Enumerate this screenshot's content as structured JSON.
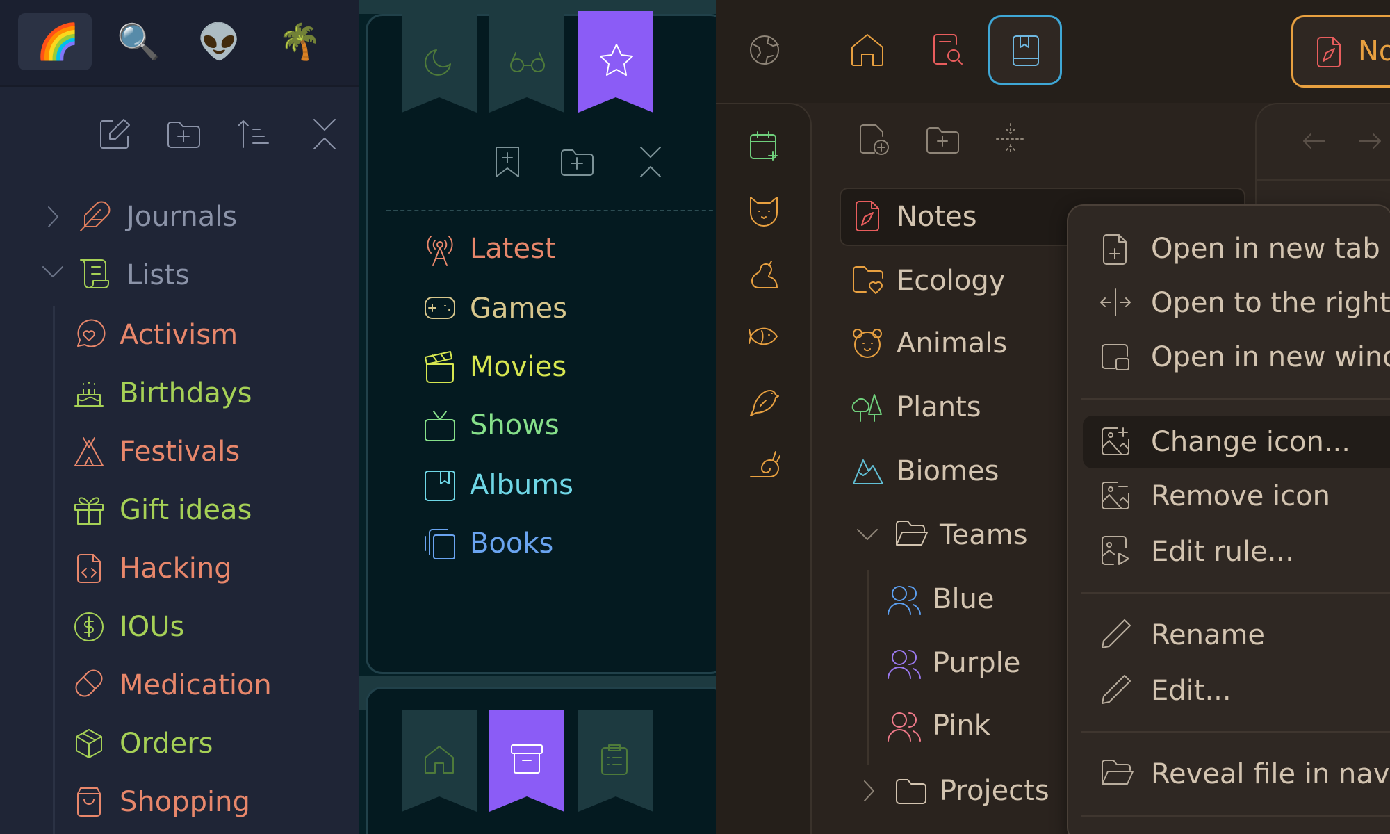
{
  "pane1": {
    "tabs": [
      "🌈",
      "🔍",
      "👽",
      "🌴"
    ],
    "folders": [
      {
        "label": "Journals",
        "color": "#e07e5c",
        "icon": "feather-icon"
      },
      {
        "label": "Lists",
        "color": "#a6d156",
        "icon": "scroll-icon"
      }
    ],
    "items": [
      {
        "label": "Activism",
        "color": "#e8876b",
        "icon": "heart-message-icon"
      },
      {
        "label": "Birthdays",
        "color": "#a6d156",
        "icon": "cake-icon"
      },
      {
        "label": "Festivals",
        "color": "#e8876b",
        "icon": "tent-icon"
      },
      {
        "label": "Gift ideas",
        "color": "#a6d156",
        "icon": "gift-icon"
      },
      {
        "label": "Hacking",
        "color": "#e8876b",
        "icon": "code-file-icon"
      },
      {
        "label": "IOUs",
        "color": "#a6d156",
        "icon": "dollar-icon"
      },
      {
        "label": "Medication",
        "color": "#e8876b",
        "icon": "pill-icon"
      },
      {
        "label": "Orders",
        "color": "#a6d156",
        "icon": "package-icon"
      },
      {
        "label": "Shopping",
        "color": "#e8876b",
        "icon": "shopping-bag-icon"
      }
    ]
  },
  "pane2": {
    "bookmarks": [
      {
        "label": "Latest",
        "color": "#e8876b",
        "icon": "radio-tower-icon"
      },
      {
        "label": "Games",
        "color": "#d7c68c",
        "icon": "gamepad-icon"
      },
      {
        "label": "Movies",
        "color": "#d6e650",
        "icon": "clapperboard-icon"
      },
      {
        "label": "Shows",
        "color": "#86e08a",
        "icon": "tv-icon"
      },
      {
        "label": "Albums",
        "color": "#6fd7e6",
        "icon": "album-icon"
      },
      {
        "label": "Books",
        "color": "#6aa4f0",
        "icon": "library-icon"
      }
    ]
  },
  "pane3": {
    "top_tab_label": "No",
    "tree": [
      {
        "label": "Notes",
        "color": "#e85d5d",
        "icon": "note-icon"
      },
      {
        "label": "Ecology",
        "color": "#e8a040",
        "icon": "folder-heart-icon"
      },
      {
        "label": "Animals",
        "color": "#e8a040",
        "icon": "bear-icon"
      },
      {
        "label": "Plants",
        "color": "#6fcf7c",
        "icon": "trees-icon"
      },
      {
        "label": "Biomes",
        "color": "#62c0d6",
        "icon": "mountain-icon"
      },
      {
        "label": "Teams",
        "color": "#d3c4b0",
        "icon": "folder-open-icon"
      },
      {
        "label": "Blue",
        "color": "#5c9ff0",
        "icon": "users-icon"
      },
      {
        "label": "Purple",
        "color": "#9b79f0",
        "icon": "users-icon"
      },
      {
        "label": "Pink",
        "color": "#f07a8a",
        "icon": "users-icon"
      },
      {
        "label": "Projects",
        "color": "#d3c4b0",
        "icon": "folder-icon"
      }
    ],
    "menu": [
      {
        "label": "Open in new tab",
        "icon": "file-plus-icon"
      },
      {
        "label": "Open to the right",
        "icon": "split-icon"
      },
      {
        "label": "Open in new wind",
        "icon": "window-icon"
      },
      {
        "label": "Change icon...",
        "icon": "image-plus-icon"
      },
      {
        "label": "Remove icon",
        "icon": "image-minus-icon"
      },
      {
        "label": "Edit rule...",
        "icon": "file-image-icon"
      },
      {
        "label": "Rename",
        "icon": "pencil-icon"
      },
      {
        "label": "Edit...",
        "icon": "pencil-icon"
      },
      {
        "label": "Reveal file in navi",
        "icon": "folder-open-icon"
      }
    ]
  }
}
